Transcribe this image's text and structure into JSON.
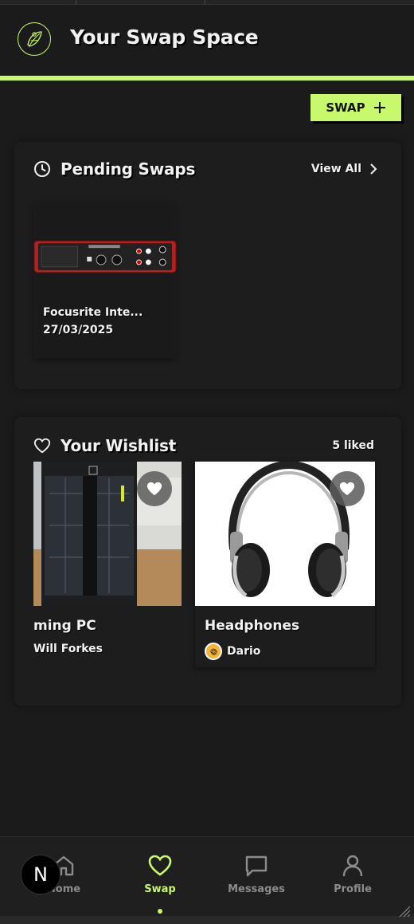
{
  "header": {
    "title": "Your Swap Space"
  },
  "actions": {
    "swap_label": "SWAP"
  },
  "pending": {
    "title": "Pending Swaps",
    "view_all": "View All",
    "items": [
      {
        "name": "Focusrite Inte...",
        "date": "27/03/2025"
      }
    ]
  },
  "wishlist": {
    "title": "Your Wishlist",
    "count_label": "5 liked",
    "items": [
      {
        "title": "ming PC",
        "owner": "Will Forkes"
      },
      {
        "title": "Headphones",
        "owner": "Dario"
      }
    ]
  },
  "nav": {
    "items": [
      {
        "label": "Home",
        "icon": "home-icon"
      },
      {
        "label": "Swap",
        "icon": "heart-icon"
      },
      {
        "label": "Messages",
        "icon": "message-icon"
      },
      {
        "label": "Profile",
        "icon": "user-icon"
      }
    ],
    "active": "Swap"
  },
  "dev_badge": {
    "letter": "N"
  },
  "colors": {
    "accent": "#c8f86b",
    "background": "#1b1b1b",
    "text": "#f2f2f2",
    "muted": "#8c8c8c"
  }
}
